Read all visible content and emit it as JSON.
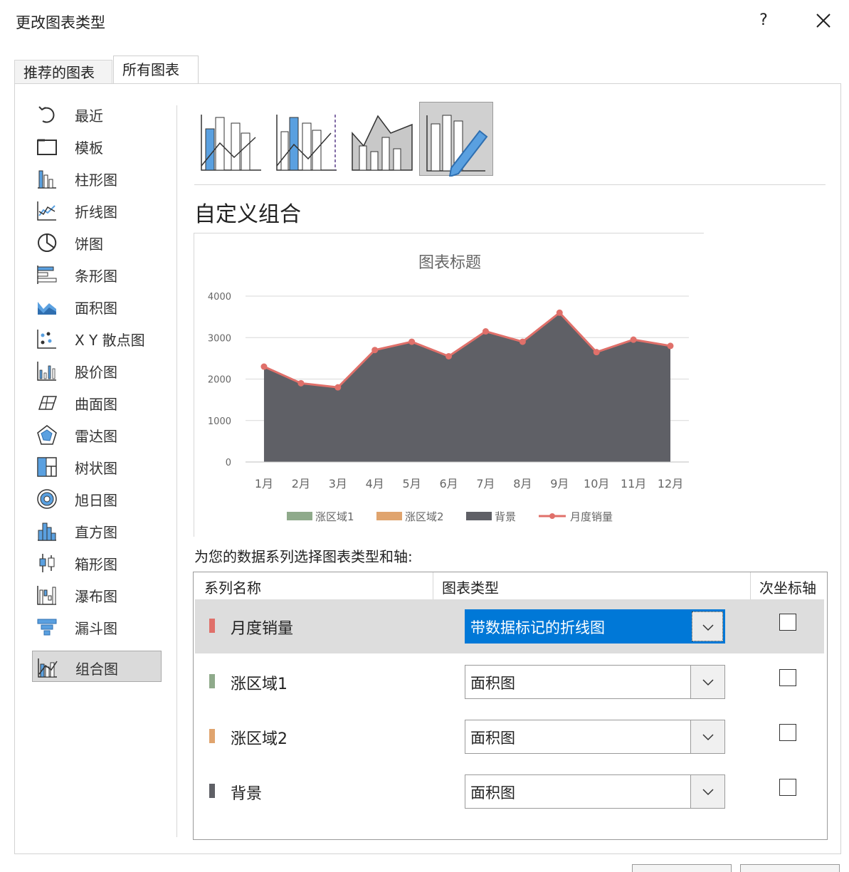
{
  "window": {
    "title": "更改图表类型",
    "help_label": "?"
  },
  "tabs": [
    {
      "label": "推荐的图表",
      "active": false
    },
    {
      "label": "所有图表",
      "active": true
    }
  ],
  "chart_types": [
    {
      "label": "最近",
      "icon": "recent-icon"
    },
    {
      "label": "模板",
      "icon": "template-icon"
    },
    {
      "label": "柱形图",
      "icon": "column-chart-icon"
    },
    {
      "label": "折线图",
      "icon": "line-chart-icon"
    },
    {
      "label": "饼图",
      "icon": "pie-chart-icon"
    },
    {
      "label": "条形图",
      "icon": "bar-chart-icon"
    },
    {
      "label": "面积图",
      "icon": "area-chart-icon"
    },
    {
      "label": "X Y 散点图",
      "icon": "scatter-chart-icon"
    },
    {
      "label": "股价图",
      "icon": "stock-chart-icon"
    },
    {
      "label": "曲面图",
      "icon": "surface-chart-icon"
    },
    {
      "label": "雷达图",
      "icon": "radar-chart-icon"
    },
    {
      "label": "树状图",
      "icon": "treemap-chart-icon"
    },
    {
      "label": "旭日图",
      "icon": "sunburst-chart-icon"
    },
    {
      "label": "直方图",
      "icon": "histogram-chart-icon"
    },
    {
      "label": "箱形图",
      "icon": "box-whisker-chart-icon"
    },
    {
      "label": "瀑布图",
      "icon": "waterfall-chart-icon"
    },
    {
      "label": "漏斗图",
      "icon": "funnel-chart-icon"
    },
    {
      "label": "组合图",
      "icon": "combo-chart-icon",
      "selected": true
    }
  ],
  "combo_subtypes": [
    {
      "icon": "clustered-column-line-icon",
      "selected": false
    },
    {
      "icon": "clustered-column-line-secondary-axis-icon",
      "selected": false
    },
    {
      "icon": "stacked-area-clustered-column-icon",
      "selected": false
    },
    {
      "icon": "custom-combination-icon",
      "selected": true
    }
  ],
  "section_title": "自定义组合",
  "chart_data": {
    "type": "area",
    "title": "图表标题",
    "categories": [
      "1月",
      "2月",
      "3月",
      "4月",
      "5月",
      "6月",
      "7月",
      "8月",
      "9月",
      "10月",
      "11月",
      "12月"
    ],
    "series": [
      {
        "name": "涨区域1",
        "type": "area",
        "color": "#8faa8b",
        "values": []
      },
      {
        "name": "涨区域2",
        "type": "area",
        "color": "#e0a46e",
        "values": []
      },
      {
        "name": "背景",
        "type": "area",
        "color": "#5f6066",
        "values": [
          2300,
          1900,
          1800,
          2700,
          2900,
          2550,
          3150,
          2900,
          3600,
          2650,
          2950,
          2800
        ]
      },
      {
        "name": "月度销量",
        "type": "line",
        "color": "#e0706a",
        "values": [
          2300,
          1900,
          1800,
          2700,
          2900,
          2550,
          3150,
          2900,
          3600,
          2650,
          2950,
          2800
        ]
      }
    ],
    "ylim": [
      0,
      4000
    ],
    "yticks": [
      "0",
      "1000",
      "2000",
      "3000",
      "4000"
    ],
    "grid": true,
    "legend_position": "bottom",
    "xlabel": "",
    "ylabel": ""
  },
  "select_prompt": "为您的数据系列选择图表类型和轴:",
  "table": {
    "headers": {
      "name": "系列名称",
      "type": "图表类型",
      "axis": "次坐标轴"
    },
    "rows": [
      {
        "name": "月度销量",
        "color": "#e0706a",
        "chart_type": "带数据标记的折线图",
        "secondary_axis": false,
        "selected": true
      },
      {
        "name": "涨区域1",
        "color": "#8faa8b",
        "chart_type": "面积图",
        "secondary_axis": false,
        "selected": false
      },
      {
        "name": "涨区域2",
        "color": "#e0a46e",
        "chart_type": "面积图",
        "secondary_axis": false,
        "selected": false
      },
      {
        "name": "背景",
        "color": "#5f6066",
        "chart_type": "面积图",
        "secondary_axis": false,
        "selected": false
      }
    ]
  },
  "colors": {
    "accent": "#0078d7",
    "icon_blue": "#5aa0e0"
  }
}
